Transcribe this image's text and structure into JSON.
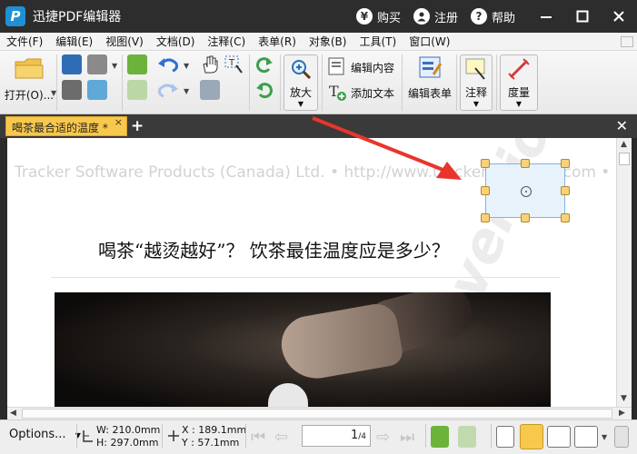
{
  "app": {
    "title": "迅捷PDF编辑器",
    "logo_letter": "P"
  },
  "titlebar": {
    "buy_label": "购买",
    "register_label": "注册",
    "help_label": "帮助"
  },
  "menu": [
    "文件(F)",
    "编辑(E)",
    "视图(V)",
    "文档(D)",
    "注释(C)",
    "表单(R)",
    "对象(B)",
    "工具(T)",
    "窗口(W)"
  ],
  "ribbon": {
    "open_label": "打开(O)...",
    "zoom_label": "放大",
    "edit_content_label": "编辑内容",
    "add_text_label": "添加文本",
    "edit_form_label": "编辑表单",
    "annotate_label": "注释",
    "measure_label": "度量"
  },
  "tab": {
    "title": "喝茶最合适的温度 *",
    "close": "×"
  },
  "document": {
    "watermark_top": "Tracker Software Products (Canada) Ltd. • http://www.tracker-software.com •",
    "watermark_diag": "version)",
    "heading": "喝茶“越烫越好”？ 饮茶最佳温度应是多少？"
  },
  "status": {
    "options_label": "Options...",
    "w_label": "W:",
    "w_value": "210.0mm",
    "h_label": "H:",
    "h_value": "297.0mm",
    "x_label": "X :",
    "x_value": "189.1mm",
    "y_label": "Y :",
    "y_value": "57.1mm",
    "page_current": "1",
    "page_total": "/4"
  },
  "colors": {
    "tab_active": "#f8c84c",
    "titlebar": "#2d2d2d",
    "accent_arrow": "#e8352b"
  }
}
